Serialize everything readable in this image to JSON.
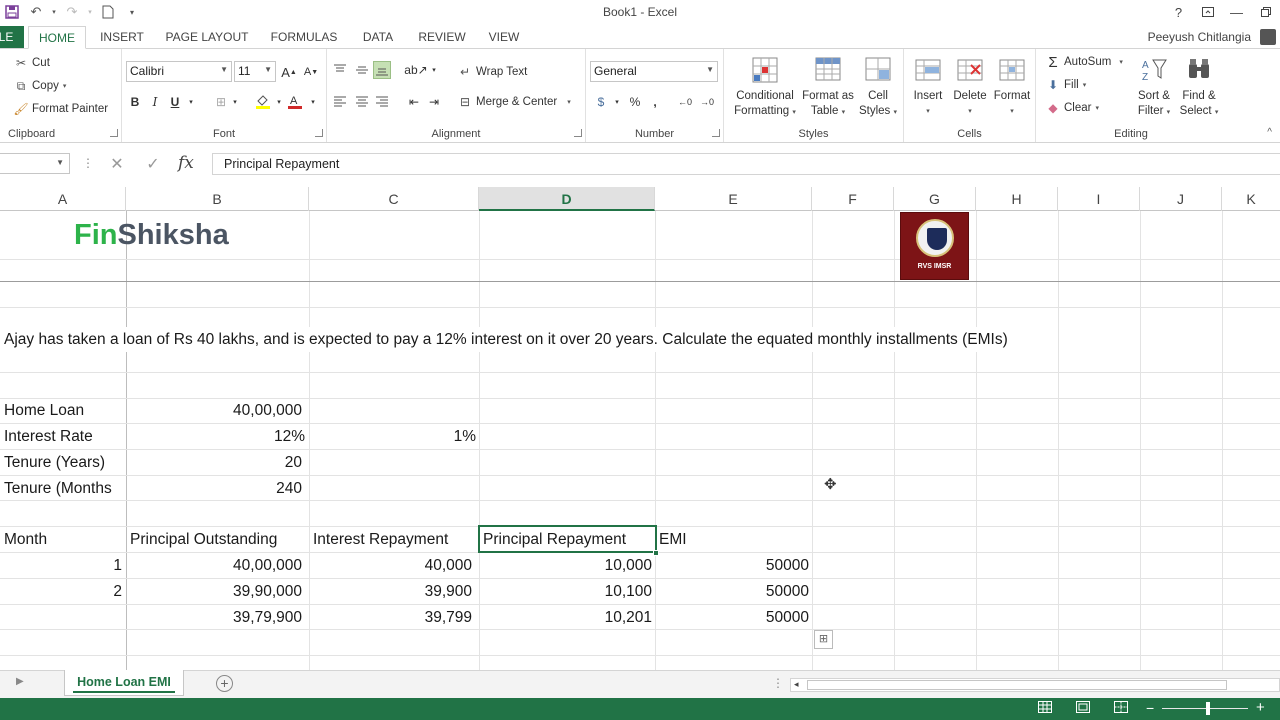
{
  "window": {
    "title": "Book1 - Excel",
    "help": "?",
    "user": "Peeyush Chitlangia"
  },
  "tabs": {
    "file": "FILE",
    "items": [
      "HOME",
      "INSERT",
      "PAGE LAYOUT",
      "FORMULAS",
      "DATA",
      "REVIEW",
      "VIEW"
    ]
  },
  "ribbon": {
    "clipboard": {
      "cut": "Cut",
      "copy": "Copy",
      "format_painter": "Format Painter",
      "label": "Clipboard"
    },
    "font": {
      "name": "Calibri",
      "size": "11",
      "bold": "B",
      "italic": "I",
      "underline": "U",
      "label": "Font"
    },
    "alignment": {
      "wrap_text": "Wrap Text",
      "merge_center": "Merge & Center",
      "label": "Alignment"
    },
    "number": {
      "format": "General",
      "percent": "%",
      "comma": ",",
      "label": "Number"
    },
    "styles": {
      "conditional_1": "Conditional",
      "conditional_2": "Formatting",
      "format_table_1": "Format as",
      "format_table_2": "Table",
      "cell_styles_1": "Cell",
      "cell_styles_2": "Styles",
      "label": "Styles"
    },
    "cells": {
      "insert": "Insert",
      "delete": "Delete",
      "format": "Format",
      "label": "Cells"
    },
    "editing": {
      "autosum": "AutoSum",
      "fill": "Fill",
      "clear": "Clear",
      "sort_1": "Sort &",
      "sort_2": "Filter",
      "find_1": "Find &",
      "find_2": "Select",
      "label": "Editing"
    }
  },
  "formula_bar": {
    "fx": "fx",
    "value": "Principal Repayment"
  },
  "columns": [
    "A",
    "B",
    "C",
    "D",
    "E",
    "F",
    "G",
    "H",
    "I",
    "J",
    "K"
  ],
  "selected_column": "D",
  "sheet": {
    "logo_fin": "Fin",
    "logo_shiksha": "Shiksha",
    "crest_text": "RVS IMSR",
    "question": "Ajay has taken a loan of Rs 40 lakhs, and is expected to pay a 12% interest on it over 20 years. Calculate the equated monthly installments (EMIs)",
    "inputs": [
      {
        "label": "Home Loan",
        "value": "40,00,000",
        "extra": ""
      },
      {
        "label": "Interest Rate",
        "value": "12%",
        "extra": "1%"
      },
      {
        "label": "Tenure (Years)",
        "value": "20",
        "extra": ""
      },
      {
        "label": "Tenure (Months",
        "value": "240",
        "extra": ""
      }
    ],
    "table_headers": [
      "Month",
      "Principal Outstanding",
      "Interest Repayment",
      "Principal Repayment",
      "EMI"
    ],
    "table_rows": [
      [
        "1",
        "40,00,000",
        "40,000",
        "10,000",
        "50000"
      ],
      [
        "2",
        "39,90,000",
        "39,900",
        "10,100",
        "50000"
      ],
      [
        "",
        "39,79,900",
        "39,799",
        "10,201",
        "50000"
      ]
    ]
  },
  "sheet_tabs": {
    "active": "Home Loan EMI"
  }
}
